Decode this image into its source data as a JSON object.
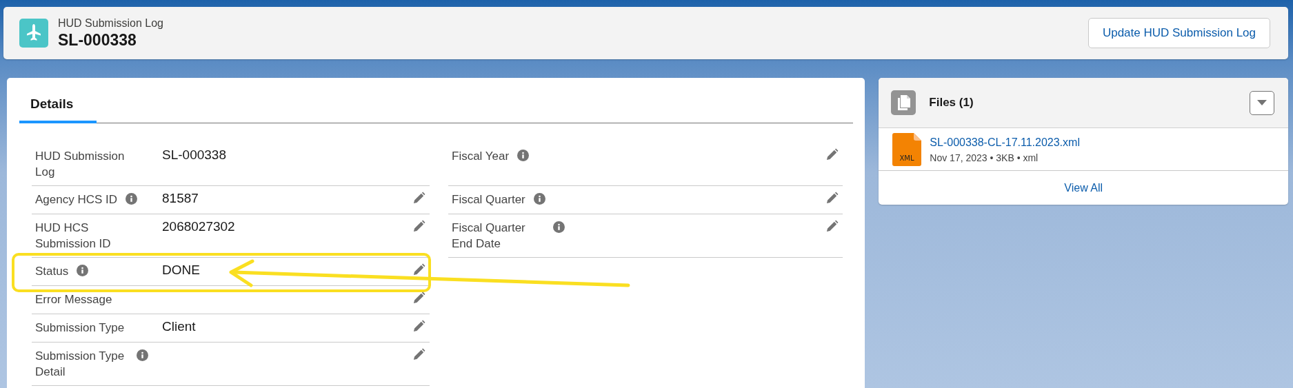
{
  "header": {
    "object_type": "HUD Submission Log",
    "record_name": "SL-000338",
    "action_button": "Update HUD Submission Log"
  },
  "details": {
    "tabs": [
      {
        "label": "Details",
        "selected": true
      }
    ],
    "left_column": [
      {
        "label": "HUD Submission Log",
        "value": "SL-000338",
        "info": false,
        "editable": false,
        "highlighted": false
      },
      {
        "label": "Agency HCS ID",
        "value": "81587",
        "info": true,
        "editable": true,
        "highlighted": false
      },
      {
        "label": "HUD HCS Submission ID",
        "value": "2068027302",
        "info": false,
        "editable": true,
        "highlighted": false
      },
      {
        "label": "Status",
        "value": "DONE",
        "info": true,
        "editable": true,
        "highlighted": true
      },
      {
        "label": "Error Message",
        "info": false,
        "editable": true,
        "highlighted": false
      },
      {
        "label": "Submission Type",
        "value": "Client",
        "info": false,
        "editable": true,
        "highlighted": false
      },
      {
        "label": "Submission Type Detail",
        "info": true,
        "editable": true,
        "highlighted": false
      }
    ],
    "right_column": [
      {
        "label": "Fiscal Year",
        "info": true,
        "editable": true,
        "highlighted": false
      },
      {
        "label": "Fiscal Quarter",
        "info": true,
        "editable": true,
        "highlighted": false
      },
      {
        "label": "Fiscal Quarter End Date",
        "info": true,
        "editable": true,
        "highlighted": false
      }
    ]
  },
  "files": {
    "title": "Files (1)",
    "items": [
      {
        "name": "SL-000338-CL-17.11.2023.xml",
        "meta": "Nov 17, 2023 • 3KB • xml",
        "icon_label": "XML"
      }
    ],
    "footer_link": "View All"
  }
}
